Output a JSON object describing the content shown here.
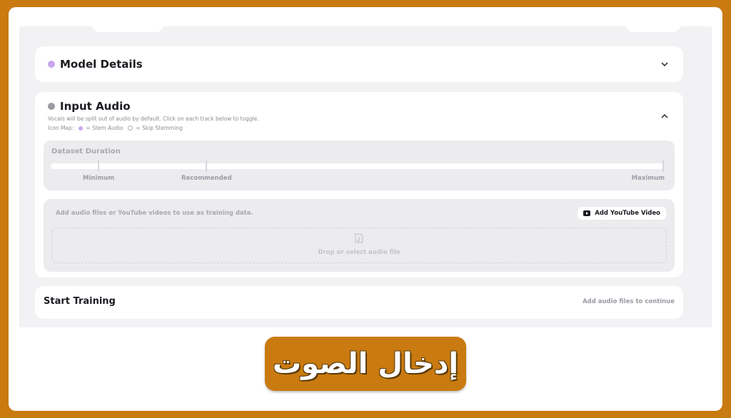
{
  "model_details": {
    "title": "Model Details"
  },
  "input_audio": {
    "title": "Input Audio",
    "description": "Vocals will be split out of audio by default. Click on each track below to toggle.",
    "icon_map_label": "Icon Map:",
    "stem_audio_label": "= Stem Audio",
    "skip_stemming_label": "= Skip Stemming",
    "dataset_duration": {
      "title": "Dataset Duration",
      "minimum": "Minimum",
      "recommended": "Recommended",
      "maximum": "Maximum"
    },
    "upload": {
      "hint": "Add audio files or YouTube videos to use as training data.",
      "youtube_button": "Add YouTube Video",
      "drop_label": "Drop or select audio file"
    }
  },
  "start_training": {
    "title": "Start Training",
    "status": "Add audio files to continue"
  },
  "banner": {
    "text": "إدخال الصوت"
  },
  "colors": {
    "accent_purple": "#c9a6f0",
    "frame_orange": "#c97a10",
    "panel_gray": "#f2f2f4"
  }
}
